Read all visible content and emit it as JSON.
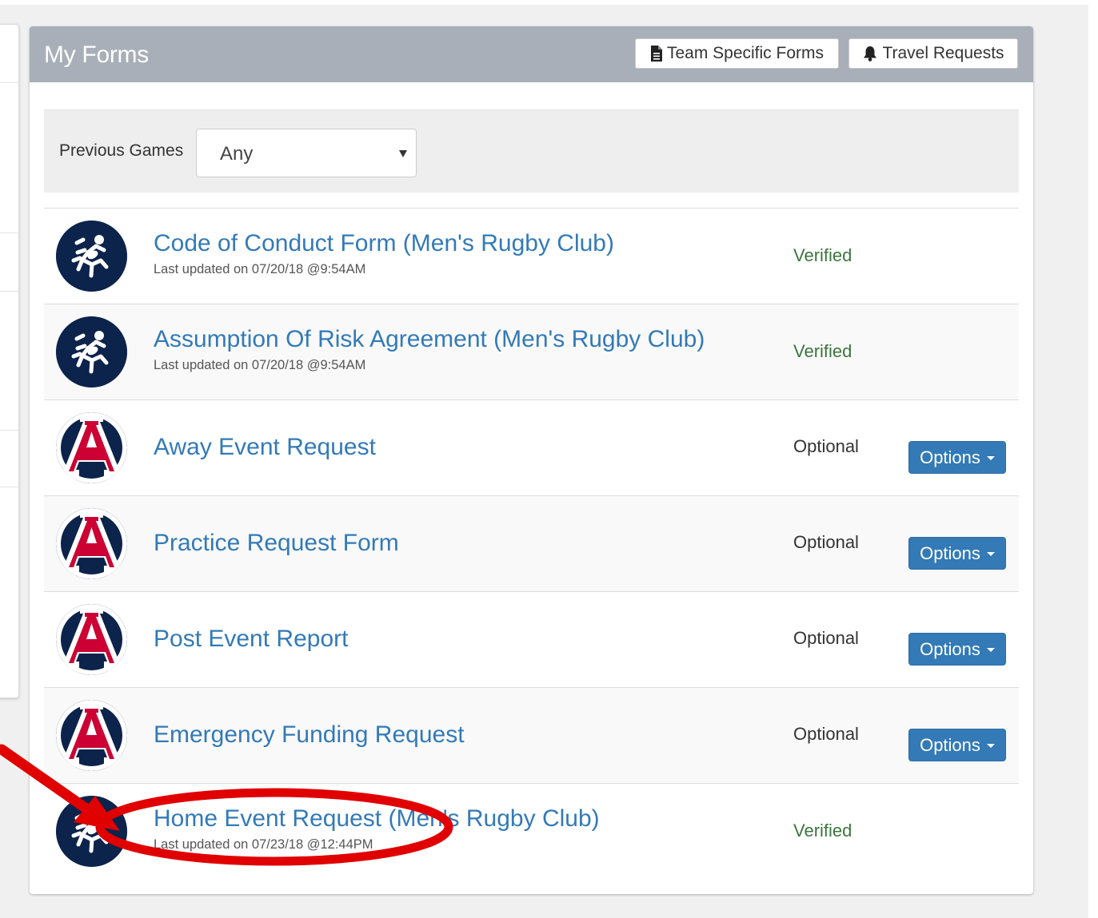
{
  "panel": {
    "title": "My Forms",
    "header_buttons": {
      "team_forms": "Team Specific Forms",
      "travel_requests": "Travel Requests"
    }
  },
  "filter": {
    "label": "Previous Games",
    "selected": "Any"
  },
  "forms": [
    {
      "title": "Code of Conduct Form (Men's Rugby Club)",
      "subtitle": "Last updated on 07/20/18 @9:54AM",
      "status": "Verified",
      "logo": "running-figure-logo"
    },
    {
      "title": "Assumption Of Risk Agreement (Men's Rugby Club)",
      "subtitle": "Last updated on 07/20/18 @9:54AM",
      "status": "Verified",
      "logo": "running-figure-logo"
    },
    {
      "title": "Away Event Request",
      "status": "Optional",
      "options_label": "Options",
      "logo": "block-a-logo"
    },
    {
      "title": "Practice Request Form",
      "status": "Optional",
      "options_label": "Options",
      "logo": "block-a-logo"
    },
    {
      "title": "Post Event Report",
      "status": "Optional",
      "options_label": "Options",
      "logo": "block-a-logo"
    },
    {
      "title": "Emergency Funding Request",
      "status": "Optional",
      "options_label": "Options",
      "logo": "block-a-logo"
    },
    {
      "title": "Home Event Request (Men's Rugby Club)",
      "subtitle": "Last updated on 07/23/18 @12:44PM",
      "status": "Verified",
      "logo": "running-figure-logo"
    }
  ],
  "colors": {
    "header_bg": "#a8afb9",
    "link": "#337ab7",
    "verified": "#3c763d",
    "primary_button": "#337ab7",
    "logo_navy": "#0c234b",
    "logo_red": "#cc0033",
    "annotation_red": "#e00000"
  }
}
